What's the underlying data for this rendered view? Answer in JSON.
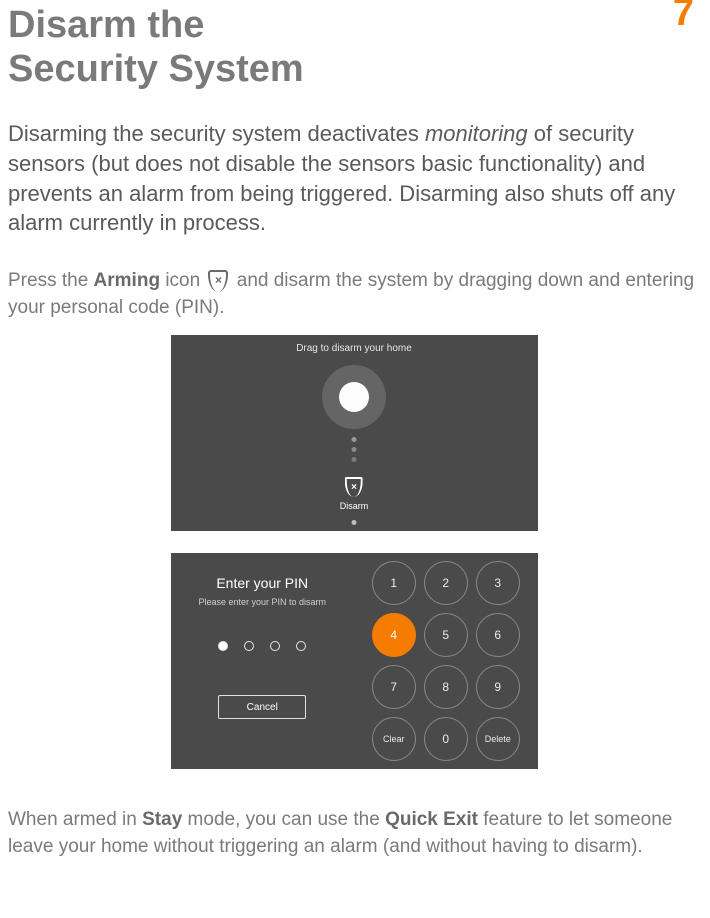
{
  "page_number": "7",
  "title_line1": "Disarm the",
  "title_line2": "Security System",
  "intro_part1": "Disarming the security system deactivates ",
  "intro_em": "monitoring",
  "intro_part2": " of security sensors (but does not disable the sensors basic functionality) and prevents an alarm from being triggered. Disarming also shuts off any alarm currently in process.",
  "instruction_pre": "Press the ",
  "instruction_bold1": "Arming",
  "instruction_mid": " icon ",
  "instruction_post": " and disarm the system by dragging down and entering your personal code (PIN).",
  "shot1": {
    "prompt": "Drag to disarm your home",
    "disarm_label": "Disarm"
  },
  "shot2": {
    "heading": "Enter your PIN",
    "sub": "Please enter your PIN to disarm",
    "cancel": "Cancel",
    "keys": [
      "1",
      "2",
      "3",
      "4",
      "5",
      "6",
      "7",
      "8",
      "9",
      "Clear",
      "0",
      "Delete"
    ],
    "active_key": "4",
    "filled_count": 1,
    "total_dots": 4
  },
  "note_pre": "When armed in ",
  "note_bold1": "Stay",
  "note_mid": " mode, you can use the ",
  "note_bold2": "Quick Exit",
  "note_post": " feature to let someone leave your home without triggering an alarm (and without having to disarm)."
}
